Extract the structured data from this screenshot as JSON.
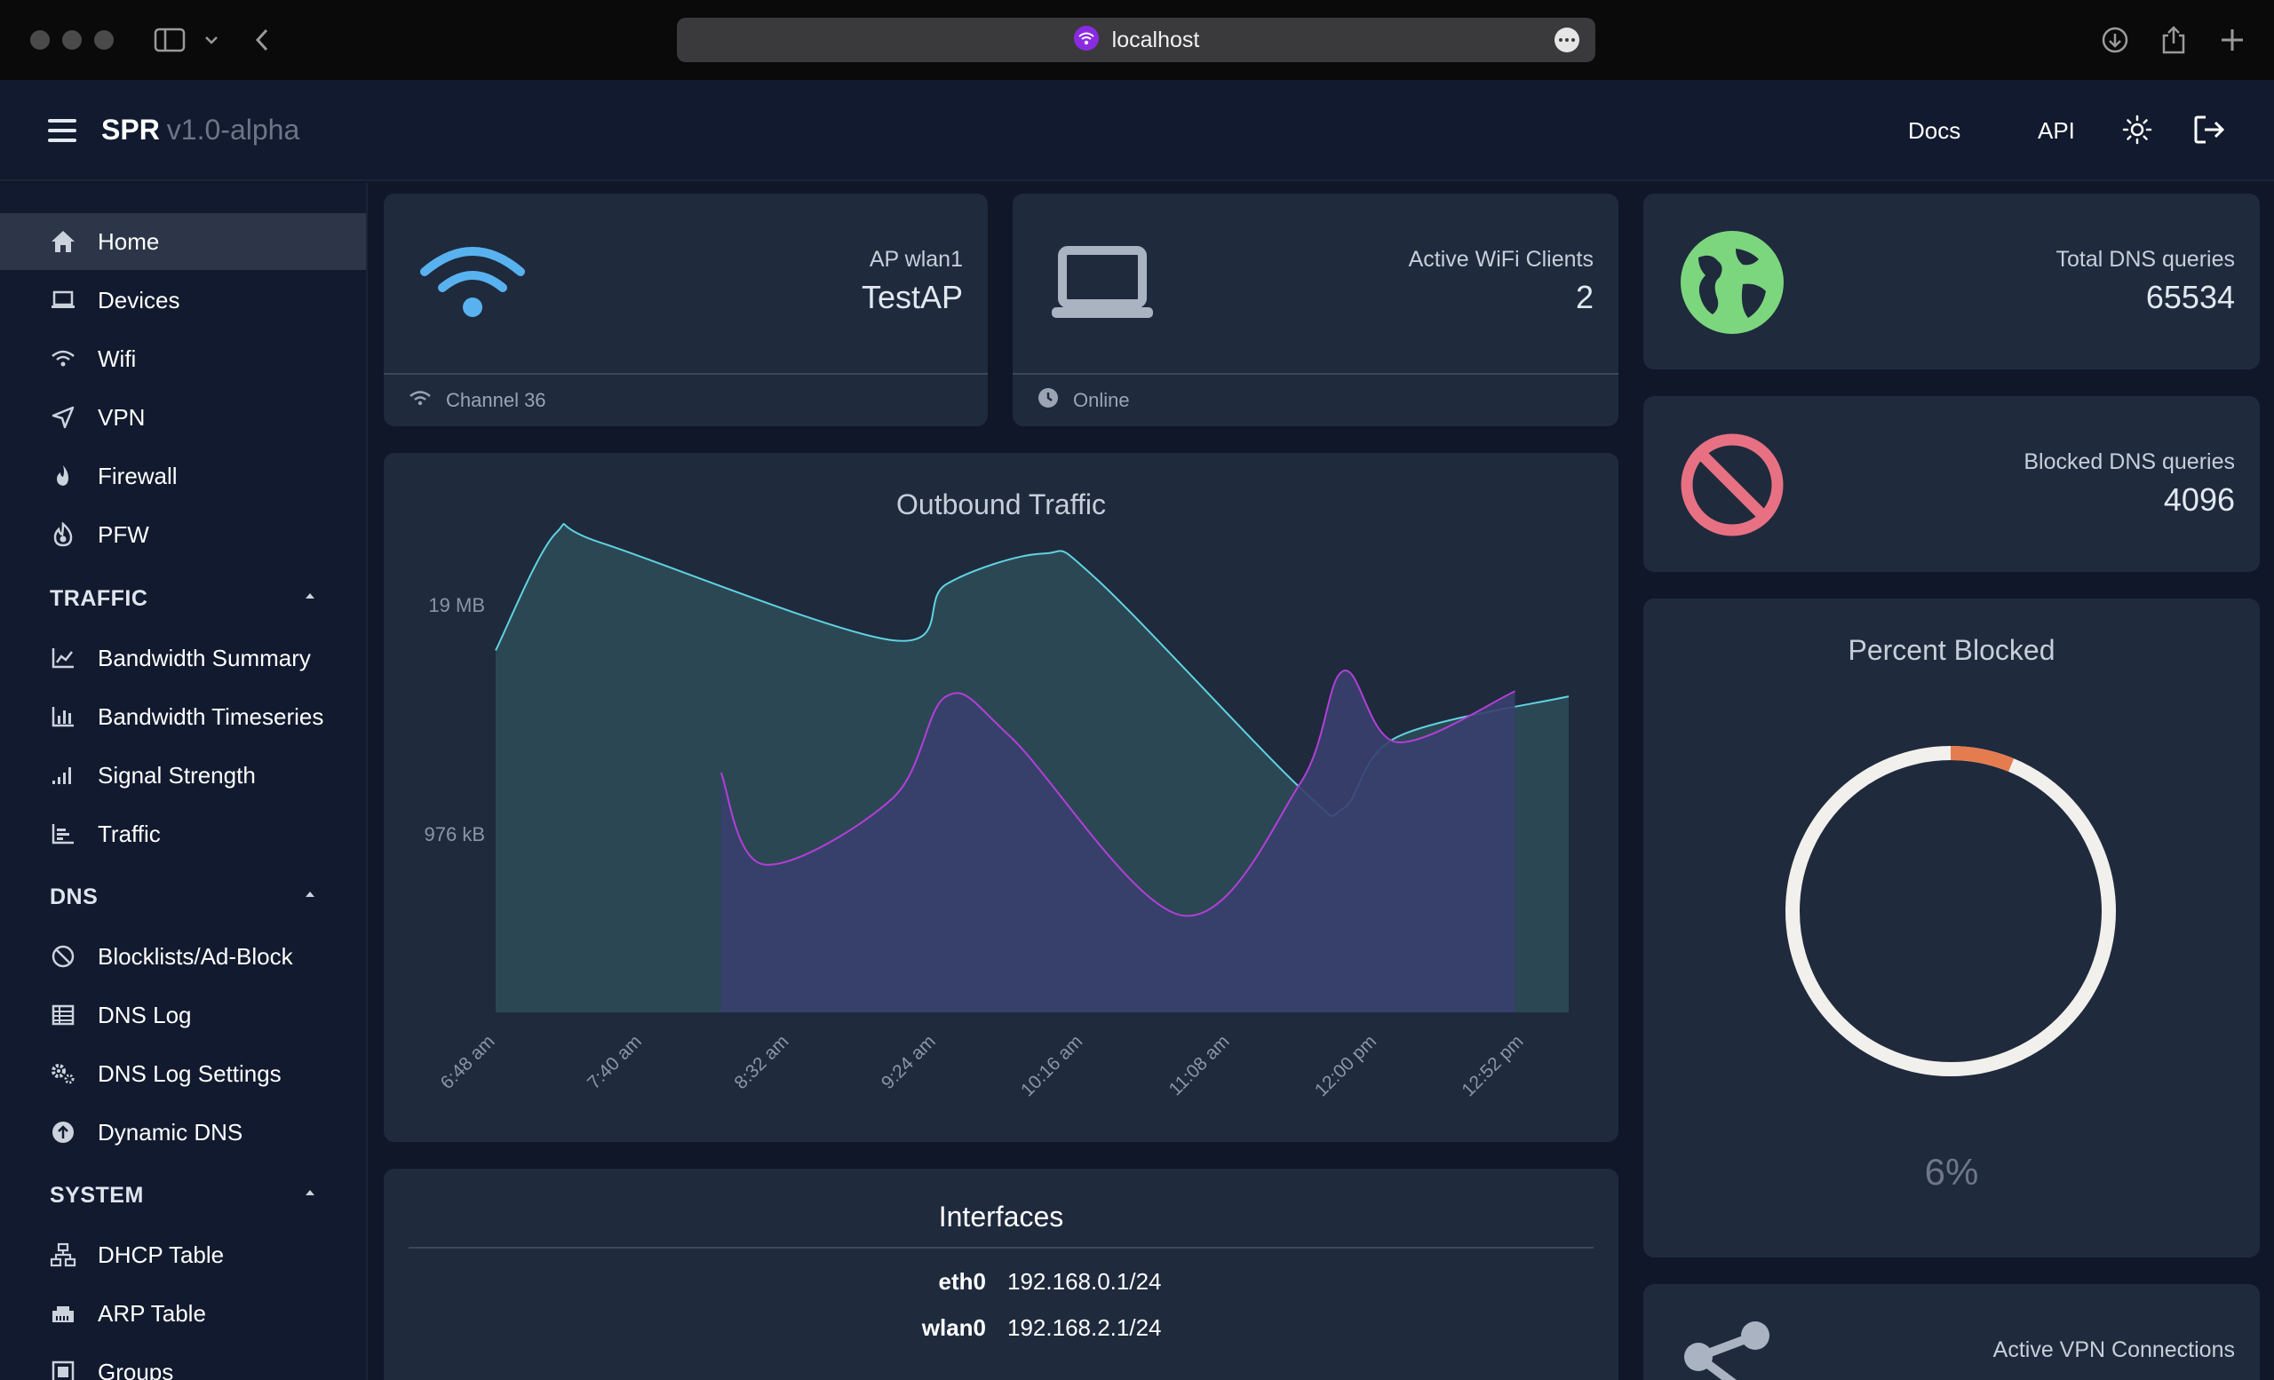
{
  "browser": {
    "url": "localhost"
  },
  "header": {
    "brand": "SPR",
    "version": "v1.0-alpha",
    "docs_label": "Docs",
    "api_label": "API"
  },
  "sidebar": {
    "items": [
      {
        "label": "Home",
        "icon": "home-icon"
      },
      {
        "label": "Devices",
        "icon": "laptop-icon"
      },
      {
        "label": "Wifi",
        "icon": "wifi-icon"
      },
      {
        "label": "VPN",
        "icon": "send-icon"
      },
      {
        "label": "Firewall",
        "icon": "flame-icon"
      },
      {
        "label": "PFW",
        "icon": "fire-icon"
      }
    ],
    "traffic_title": "TRAFFIC",
    "traffic_items": [
      {
        "label": "Bandwidth Summary",
        "icon": "line-chart-icon"
      },
      {
        "label": "Bandwidth Timeseries",
        "icon": "bar-chart-icon"
      },
      {
        "label": "Signal Strength",
        "icon": "signal-icon"
      },
      {
        "label": "Traffic",
        "icon": "area-chart-icon"
      }
    ],
    "dns_title": "DNS",
    "dns_items": [
      {
        "label": "Blocklists/Ad-Block",
        "icon": "ban-icon"
      },
      {
        "label": "DNS Log",
        "icon": "table-icon"
      },
      {
        "label": "DNS Log Settings",
        "icon": "gears-icon"
      },
      {
        "label": "Dynamic DNS",
        "icon": "arrow-circle-up-icon"
      }
    ],
    "system_title": "SYSTEM",
    "system_items": [
      {
        "label": "DHCP Table",
        "icon": "network-icon"
      },
      {
        "label": "ARP Table",
        "icon": "ethernet-icon"
      },
      {
        "label": "Groups",
        "icon": "groups-icon"
      }
    ]
  },
  "cards": {
    "ap": {
      "label": "AP wlan1",
      "value": "TestAP",
      "footer": "Channel 36"
    },
    "clients": {
      "label": "Active WiFi Clients",
      "value": "2",
      "footer": "Online"
    },
    "dns_total": {
      "label": "Total DNS queries",
      "value": "65534"
    },
    "dns_blocked": {
      "label": "Blocked DNS queries",
      "value": "4096"
    },
    "percent_blocked": {
      "title": "Percent Blocked",
      "value": "6%",
      "fraction": 0.0625
    },
    "vpn": {
      "label": "Active VPN Connections"
    },
    "interfaces": {
      "title": "Interfaces",
      "rows": [
        {
          "name": "eth0",
          "ip": "192.168.0.1/24"
        },
        {
          "name": "wlan0",
          "ip": "192.168.2.1/24"
        }
      ]
    }
  },
  "colors": {
    "series_outbound": "#5fd3e1",
    "series_inbound": "#b23fd8",
    "fill_outbound": "#2d4a57",
    "fill_inbound": "#393f6e",
    "dns_ok": "#7cd67e",
    "dns_blocked": "#e77182",
    "donut_bg": "#f2f0ec",
    "donut_fill": "#e57c4f"
  },
  "chart_data": {
    "type": "area",
    "title": "Outbound Traffic",
    "x": [
      "6:48 am",
      "7:40 am",
      "8:32 am",
      "9:24 am",
      "10:16 am",
      "11:08 am",
      "12:00 pm",
      "12:52 pm"
    ],
    "y_ticks": [
      "19 MB",
      "976 kB"
    ],
    "series": [
      {
        "color": "#5fd3e1",
        "points": [
          [
            0.0,
            0.29
          ],
          [
            0.056,
            0.06
          ],
          [
            0.1,
            0.08
          ],
          [
            0.37,
            0.27
          ],
          [
            0.42,
            0.16
          ],
          [
            0.51,
            0.1
          ],
          [
            0.56,
            0.15
          ],
          [
            0.75,
            0.56
          ],
          [
            0.79,
            0.6
          ],
          [
            0.84,
            0.46
          ],
          [
            1.0,
            0.38
          ]
        ]
      },
      {
        "color": "#b23fd8",
        "points": [
          [
            0.21,
            0.53
          ],
          [
            0.25,
            0.71
          ],
          [
            0.37,
            0.58
          ],
          [
            0.42,
            0.38
          ],
          [
            0.48,
            0.46
          ],
          [
            0.64,
            0.81
          ],
          [
            0.75,
            0.55
          ],
          [
            0.79,
            0.33
          ],
          [
            0.84,
            0.47
          ],
          [
            0.95,
            0.37
          ]
        ]
      }
    ]
  }
}
